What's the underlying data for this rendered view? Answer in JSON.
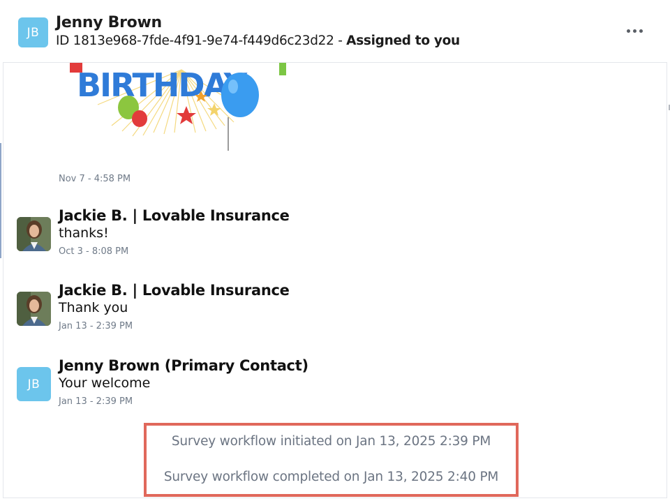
{
  "header": {
    "avatar_initials": "JB",
    "name": "Jenny Brown",
    "id_text": "ID 1813e968-7fde-4f91-9e74-f449d6c23d22 -",
    "assigned_text": "Assigned to you",
    "more_icon": "more-horizontal-icon"
  },
  "gif_message": {
    "image_alt": "Happy birthday GIF with balloons",
    "image_text": "BIRTHDAY",
    "timestamp": "Nov 7 - 4:58 PM"
  },
  "messages": [
    {
      "sender": "Jackie B. | Lovable Insurance",
      "text": "thanks!",
      "timestamp": "Oct 3 - 8:08 PM",
      "avatar": "photo"
    },
    {
      "sender": "Jackie B. | Lovable Insurance",
      "text": "Thank you",
      "timestamp": "Jan 13 - 2:39 PM",
      "avatar": "photo"
    },
    {
      "sender": "Jenny Brown (Primary Contact)",
      "text": "Your welcome",
      "timestamp": "Jan 13 - 2:39 PM",
      "avatar": "initials",
      "avatar_initials": "JB"
    }
  ],
  "survey_events": {
    "initiated": "Survey workflow initiated on Jan 13, 2025 2:39 PM",
    "completed": "Survey workflow completed on Jan 13, 2025 2:40 PM",
    "highlight_color": "#e0685b"
  },
  "colors": {
    "avatar_bg": "#6cc5ec",
    "timestamp": "#6f7a88",
    "survey_text": "#6b7482"
  }
}
